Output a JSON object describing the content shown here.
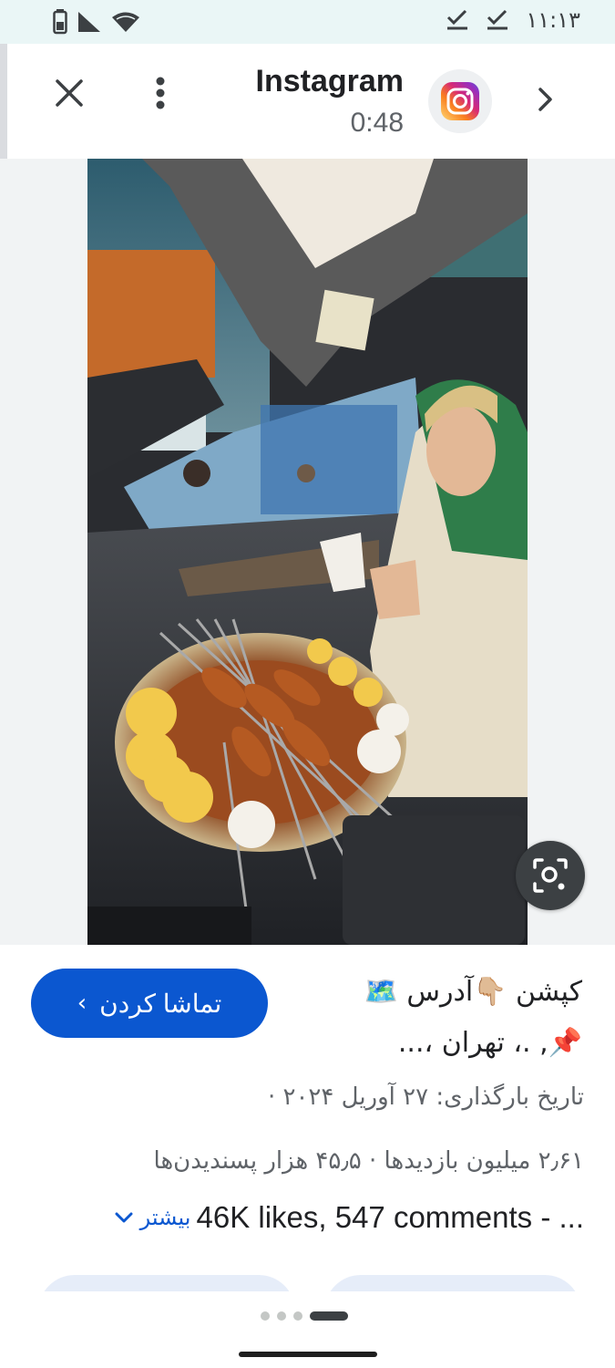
{
  "status_bar": {
    "time": "۱۱:۱۳",
    "icons": [
      "battery-icon",
      "signal-icon",
      "wifi-icon",
      "check-notification-icon",
      "check-notification-icon"
    ]
  },
  "header": {
    "title": "Instagram",
    "duration": "0:48",
    "source_icon": "instagram-logo-icon",
    "close_icon": "close-icon",
    "more_icon": "more-vert-icon",
    "next_icon": "chevron-right-icon"
  },
  "media": {
    "lens_icon": "lens-search-icon"
  },
  "info": {
    "watch_button_label": "تماشا کردن",
    "caption_line1": "کپشن 👇🏼آدرس 🗺️",
    "caption_line2": "📌, .، تهران ،...",
    "upload_date": "تاریخ بارگذاری: ۲۷ آوریل ۲۰۲۴ ·",
    "stats": "۲٫۶۱ میلیون بازدیدها · ۴۵٫۵ هزار پسندیدن‌ها",
    "likes_text": "46K likes, 547 comments - ...",
    "more_label": "بیشتر"
  },
  "pagination": {
    "total": 4,
    "active": 4
  },
  "colors": {
    "accent": "#0b57d0",
    "status_bar_bg": "#eaf6f6",
    "media_bg": "#f1f3f4"
  }
}
